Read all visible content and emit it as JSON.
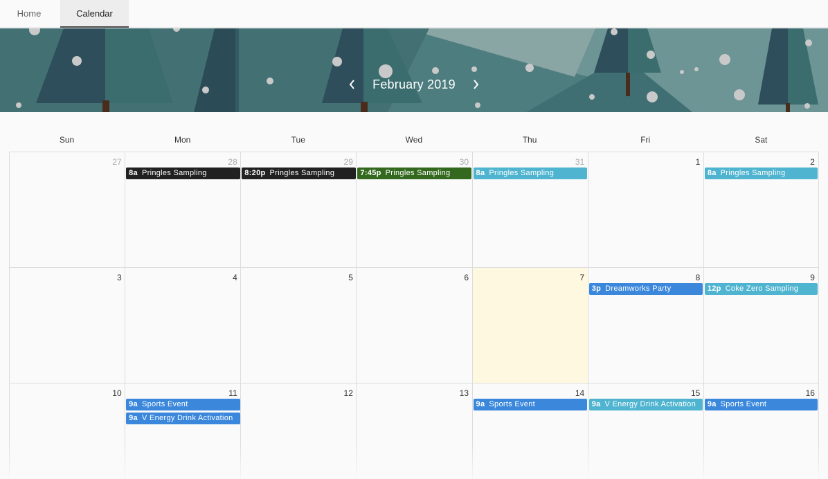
{
  "tabs": [
    {
      "label": "Home",
      "active": false
    },
    {
      "label": "Calendar",
      "active": true
    }
  ],
  "header": {
    "month": "February 2019",
    "prev_icon": "chevron-left-icon",
    "next_icon": "chevron-right-icon"
  },
  "weekdays": [
    "Sun",
    "Mon",
    "Tue",
    "Wed",
    "Thu",
    "Fri",
    "Sat"
  ],
  "colors": {
    "black": "#212121",
    "green": "#33691e",
    "teal": "#4fb4d0",
    "blue": "#3a87dc",
    "today": "#fff8e1"
  },
  "weeks": [
    [
      {
        "day": "27",
        "other": true,
        "events": []
      },
      {
        "day": "28",
        "other": true,
        "events": [
          {
            "time": "8a",
            "title": "Pringles Sampling",
            "color": "#212121"
          }
        ]
      },
      {
        "day": "29",
        "other": true,
        "events": [
          {
            "time": "8:20p",
            "title": "Pringles Sampling",
            "color": "#212121"
          }
        ]
      },
      {
        "day": "30",
        "other": true,
        "events": [
          {
            "time": "7:45p",
            "title": "Pringles Sampling",
            "color": "#33691e"
          }
        ]
      },
      {
        "day": "31",
        "other": true,
        "events": [
          {
            "time": "8a",
            "title": "Pringles Sampling",
            "color": "#4fb4d0"
          }
        ]
      },
      {
        "day": "1",
        "other": false,
        "events": []
      },
      {
        "day": "2",
        "other": false,
        "events": [
          {
            "time": "8a",
            "title": "Pringles Sampling",
            "color": "#4fb4d0"
          }
        ]
      }
    ],
    [
      {
        "day": "3",
        "other": false,
        "events": []
      },
      {
        "day": "4",
        "other": false,
        "events": []
      },
      {
        "day": "5",
        "other": false,
        "events": []
      },
      {
        "day": "6",
        "other": false,
        "events": []
      },
      {
        "day": "7",
        "other": false,
        "today": true,
        "events": []
      },
      {
        "day": "8",
        "other": false,
        "events": [
          {
            "time": "3p",
            "title": "Dreamworks Party",
            "color": "#3a87dc"
          }
        ]
      },
      {
        "day": "9",
        "other": false,
        "events": [
          {
            "time": "12p",
            "title": "Coke Zero Sampling",
            "color": "#4fb4d0"
          }
        ]
      }
    ],
    [
      {
        "day": "10",
        "other": false,
        "events": []
      },
      {
        "day": "11",
        "other": false,
        "events": [
          {
            "time": "9a",
            "title": "Sports Event",
            "color": "#3a87dc"
          },
          {
            "time": "9a",
            "title": "V Energy Drink Activation",
            "color": "#3a87dc"
          }
        ]
      },
      {
        "day": "12",
        "other": false,
        "events": []
      },
      {
        "day": "13",
        "other": false,
        "events": []
      },
      {
        "day": "14",
        "other": false,
        "events": [
          {
            "time": "9a",
            "title": "Sports Event",
            "color": "#3a87dc"
          }
        ]
      },
      {
        "day": "15",
        "other": false,
        "events": [
          {
            "time": "9a",
            "title": "V Energy Drink Activation",
            "color": "#4fb4d0"
          }
        ]
      },
      {
        "day": "16",
        "other": false,
        "events": [
          {
            "time": "9a",
            "title": "Sports Event",
            "color": "#3a87dc"
          }
        ]
      }
    ]
  ]
}
